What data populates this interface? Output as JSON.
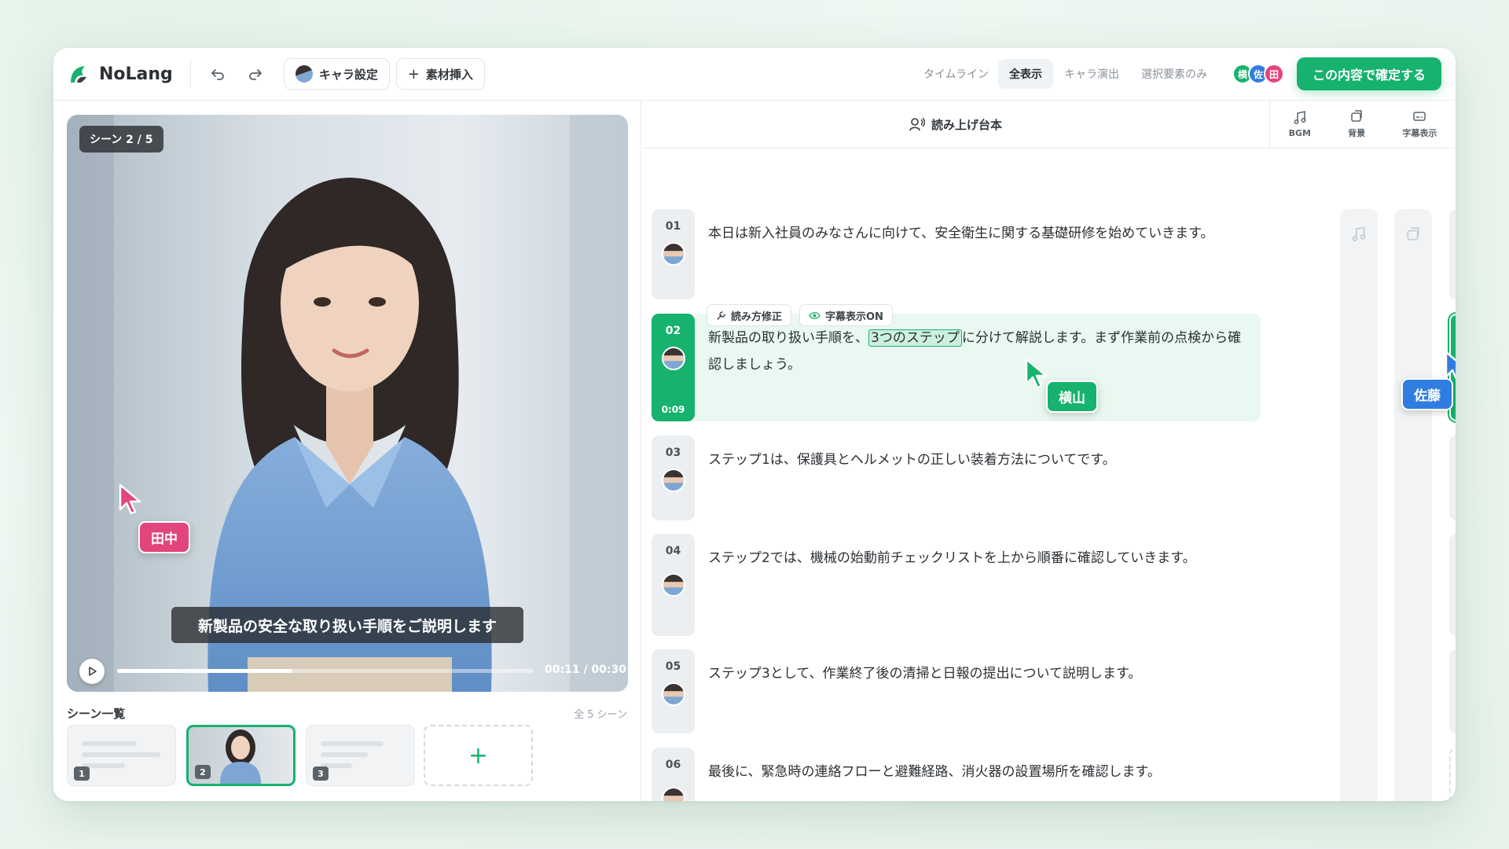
{
  "app": {
    "name": "NoLang"
  },
  "toolbar": {
    "chara_settings": "キャラ設定",
    "insert_material": "素材挿入",
    "timeline_label": "タイムライン",
    "view_tabs": [
      "全表示",
      "キャラ演出",
      "選択要素のみ"
    ],
    "collaborators": [
      {
        "initial": "横",
        "color": "#16b26e"
      },
      {
        "initial": "佐",
        "color": "#2f7de1"
      },
      {
        "initial": "田",
        "color": "#e2457c"
      }
    ],
    "confirm": "この内容で確定する"
  },
  "preview": {
    "scene_badge": "シーン 2 / 5",
    "subtitle": "新製品の安全な取り扱い手順をご説明します",
    "time": "00:11 / 00:30",
    "progress": 0.42
  },
  "scenes": {
    "label": "シーン一覧",
    "count": "全 5 シーン",
    "thumbs": [
      "1",
      "2",
      "3"
    ]
  },
  "script": {
    "header": "読み上げ台本",
    "columns": [
      "BGM",
      "背景",
      "字幕表示"
    ],
    "chips": [
      "読み方修正",
      "字幕表示ON"
    ],
    "rows": [
      {
        "num": "01",
        "text": "本日は新入社員のみなさんに向けて、安全衛生に関する基礎研修を始めていきます。"
      },
      {
        "num": "02",
        "text_before": "新製品の取り扱い手順を、",
        "highlight": "3つのステップ",
        "text_after": "に分けて解説します。まず作業前の点検から確認しましょう。",
        "duration": "0:09"
      },
      {
        "num": "03",
        "text": "ステップ1は、保護具とヘルメットの正しい装着方法についてです。"
      },
      {
        "num": "04",
        "text": "ステップ2では、機械の始動前チェックリストを上から順番に確認していきます。"
      },
      {
        "num": "05",
        "text": "ステップ3として、作業終了後の清掃と日報の提出について説明します。"
      },
      {
        "num": "06",
        "text": "最後に、緊急時の連絡フローと避難経路、消火器の設置場所を確認します。"
      }
    ]
  },
  "cursors": [
    {
      "name": "田中",
      "color": "#e2457c"
    },
    {
      "name": "横山",
      "color": "#16b26e"
    },
    {
      "name": "佐藤",
      "color": "#2f7de1"
    }
  ]
}
